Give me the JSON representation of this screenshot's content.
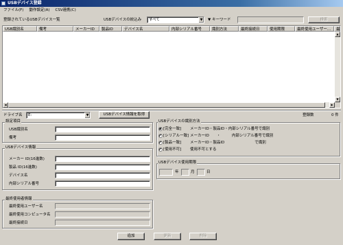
{
  "window": {
    "title": "USBデバイス登録"
  },
  "menu": [
    {
      "label": "ファイル(F)"
    },
    {
      "label": "動作設定(A)"
    },
    {
      "label": "CSV連携(C)"
    }
  ],
  "list_section": {
    "title": "登録されているUSBデバイス一覧",
    "filter_label": "USBデバイスの絞込み",
    "filter_value": "すべて",
    "keyword_label": "キーワード",
    "keyword_value": "",
    "search_button": "検索",
    "columns": [
      "USB識別名",
      "備考",
      "メーカーID",
      "製品ID",
      "デバイス名",
      "内部シリアル番号",
      "識別方法",
      "最終接続日",
      "使用期限",
      "最終使用ユーザー...",
      "最終"
    ]
  },
  "drive": {
    "label": "ドライブ名",
    "value": "E:",
    "get_info_button": "USBデバイス情報を取得"
  },
  "count": {
    "label": "登録数",
    "value": "0 件"
  },
  "settings": {
    "title": "設定項目",
    "usb_name_label": "USB識別名",
    "usb_name_value": "",
    "note_label": "備考",
    "note_value": ""
  },
  "device_info": {
    "title": "USBデバイス情報",
    "maker_id_label": "メーカー ID(16進数)",
    "maker_id_value": "",
    "product_id_label": "製品 ID(16進数)",
    "product_id_value": "",
    "device_name_label": "デバイス名",
    "device_name_value": "",
    "serial_label": "内部シリアル番号",
    "serial_value": ""
  },
  "last_user": {
    "title": "最終使用者情報",
    "user_label": "最終使用ユーザー名",
    "user_value": "",
    "computer_label": "最終使用コンピュータ名",
    "computer_value": "",
    "date_label": "最終接続日",
    "date_value": ""
  },
  "identify": {
    "title": "USBデバイスの識別方法",
    "options": [
      {
        "name": "[完全一致]",
        "desc": "メーカーID・製品ID・内部シリアル番号で識別",
        "selected": true
      },
      {
        "name": "[シリアル一致]",
        "desc": "メーカーID　　・　　　内部シリアル番号で識別",
        "selected": false
      },
      {
        "name": "[製品一致]",
        "desc": "メーカーID・製品ID　　　　　　　　で識別",
        "selected": false
      },
      {
        "name": "[使用不可]",
        "desc": "使用不可とする",
        "selected": false
      }
    ]
  },
  "expiry": {
    "title": "USBデバイス使用期限",
    "year_value": "",
    "year_label": "年",
    "month_value": "",
    "month_label": "月",
    "day_value": "",
    "day_label": "日"
  },
  "actions": {
    "add": "追加",
    "update": "更新",
    "delete": "削除"
  }
}
